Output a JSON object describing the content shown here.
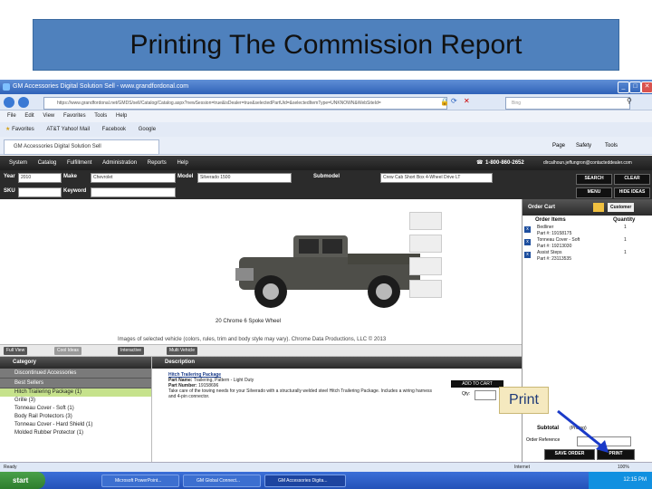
{
  "slide": {
    "title": "Printing The Commission Report"
  },
  "browser": {
    "window_title": "GM Accessories Digital Solution Sell - www.grandfordonal.com",
    "address": "https://www.grandfordonal.net/GMDS/sell/Catalog/Catalog.aspx?newSession=true&isDealer=true&selectedPartUid=&selectedItemType=UNKNOWN&WebSiteId=",
    "search_placeholder": "Bing",
    "menu": [
      "File",
      "Edit",
      "View",
      "Favorites",
      "Tools",
      "Help"
    ],
    "favorites": [
      "Favorites",
      "AT&T Yahoo! Mail",
      "Facebook",
      "Google"
    ],
    "tab_label": "GM Accessories Digital Solution Sell",
    "tools": [
      "Page",
      "Safety",
      "Tools"
    ]
  },
  "app": {
    "nav": [
      "System",
      "Catalog",
      "Fulfillment",
      "Administration",
      "Reports",
      "Help"
    ],
    "phone": "1-800-860-2652",
    "user_email": "dlrcalhoun.jeffungron@contacteddealer.com",
    "filters": {
      "year_label": "Year",
      "year_value": "2010",
      "make_label": "Make",
      "make_value": "Chevrolet",
      "model_label": "Model",
      "model_value": "Silverado 1500",
      "submodel_label": "Submodel",
      "submodel_value": "Crew Cab Short Box 4-Wheel Drive LT",
      "sku_label": "SKU",
      "keyword_label": "Keyword",
      "search_btn": "SEARCH",
      "clear_btn": "CLEAR",
      "menu_btn": "MENU",
      "hide_btn": "HIDE IDEAS"
    },
    "vehicle": {
      "caption": "20 Chrome 6 Spoke Wheel",
      "copyright": "Images of selected vehicle (colors, rules, trim and body style may vary). Chrome Data Productions, LLC © 2013"
    },
    "toolbar": [
      "Full View",
      "Cool Ideas",
      "Interactive",
      "Multi Vehicle"
    ],
    "category": {
      "header": "Category",
      "groups": [
        "Discontinued Accessories",
        "Best Sellers"
      ],
      "items": [
        "Hitch Trailering Package (1)",
        "Grille (3)",
        "Tonneau Cover - Soft (1)",
        "Body Rail Protectors (3)",
        "Tonneau Cover - Hard Shield (1)",
        "Molded Rubber Protector (1)"
      ]
    },
    "description": {
      "header": "Description",
      "title": "Hitch Trailering Package",
      "part_name_label": "Part Name:",
      "part_name": "Trailering, Pattern - Light Duty",
      "part_number_label": "Part Number:",
      "part_number": "19158696",
      "text": "Take care of the towing needs for your Silverado with a structurally welded steel Hitch Trailering Package. Includes a wiring harness and 4-pin connector.",
      "add_to_cart": "ADD TO CART",
      "qty_label": "Qty:"
    },
    "order_cart": {
      "header": "Order Cart",
      "customer_btn": "Customer",
      "col_items": "Order Items",
      "col_qty": "Quantity",
      "items": [
        {
          "name": "Bedliner",
          "part": "Part #: 19158175",
          "qty": "1"
        },
        {
          "name": "Tonneau Cover - Soft",
          "part": "Part #: 19213030",
          "qty": "1"
        },
        {
          "name": "Assist Steps",
          "part": "Part #: 23113535",
          "qty": "1"
        }
      ],
      "subtotal_label": "Subtotal",
      "subtotal_value": "(Pricing)",
      "order_ref_label": "Order Reference",
      "save_btn": "SAVE ORDER",
      "print_btn": "PRINT"
    },
    "callout": "Print"
  },
  "statusbar": {
    "left": "Ready",
    "zone": "Internet",
    "zoom": "100%"
  },
  "taskbar": {
    "start": "start",
    "tasks": [
      "Microsoft PowerPoint...",
      "GM Global Connect...",
      "GM Accessories Digita..."
    ],
    "clock": "12:15 PM"
  }
}
